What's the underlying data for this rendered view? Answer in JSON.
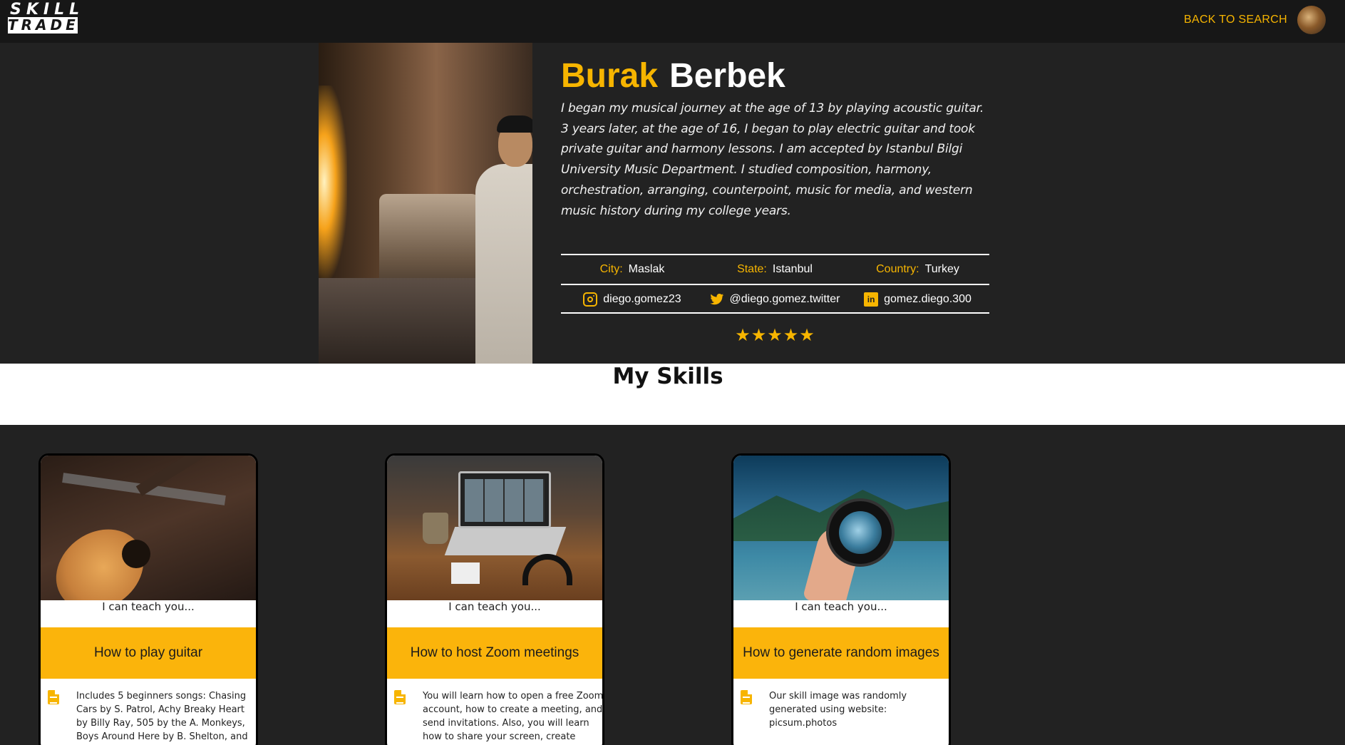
{
  "nav": {
    "logo_line1": "SKILL",
    "logo_line2": "TRADE",
    "back_link": "BACK TO SEARCH"
  },
  "profile": {
    "first_name": "Burak",
    "last_name": "Berbek",
    "bio": "I began my musical journey at the age of 13 by playing acoustic guitar. 3 years later, at the age of 16, I began to play electric guitar and took private guitar and harmony lessons. I am accepted by Istanbul Bilgi University Music Department. I studied composition, harmony, orchestration, arranging, counterpoint, music for media, and western music history during my college years.",
    "location": {
      "city_label": "City:",
      "city": "Maslak",
      "state_label": "State:",
      "state": "Istanbul",
      "country_label": "Country:",
      "country": "Turkey"
    },
    "social": {
      "instagram": "diego.gomez23",
      "twitter": "@diego.gomez.twitter",
      "linkedin": "gomez.diego.300"
    },
    "rating": 5,
    "stars": "★★★★★"
  },
  "skills_section": {
    "title": "My Skills"
  },
  "skills": [
    {
      "teach_label": "I can teach you...",
      "title": "How to play guitar",
      "description": "Includes 5 beginners songs: Chasing Cars by S. Patrol, Achy Breaky Heart by Billy Ray, 505 by the A. Monkeys, Boys Around Here by B. Shelton, and Just"
    },
    {
      "teach_label": "I can teach you...",
      "title": "How to host Zoom meetings",
      "description": "You will learn how to open a free Zoom account, how to create a meeting, and send invitations. Also, you will learn how to share your screen, create"
    },
    {
      "teach_label": "I can teach you...",
      "title": "How to generate random images",
      "description": "Our skill image was randomly generated using website: picsum.photos"
    }
  ],
  "colors": {
    "accent": "#f7b500",
    "background": "#222222",
    "topbar": "#171717",
    "card_title_bg": "#fbb40b"
  },
  "icons": {
    "instagram": "instagram-icon",
    "twitter": "twitter-icon",
    "linkedin": "linkedin-icon",
    "description": "document-icon"
  }
}
